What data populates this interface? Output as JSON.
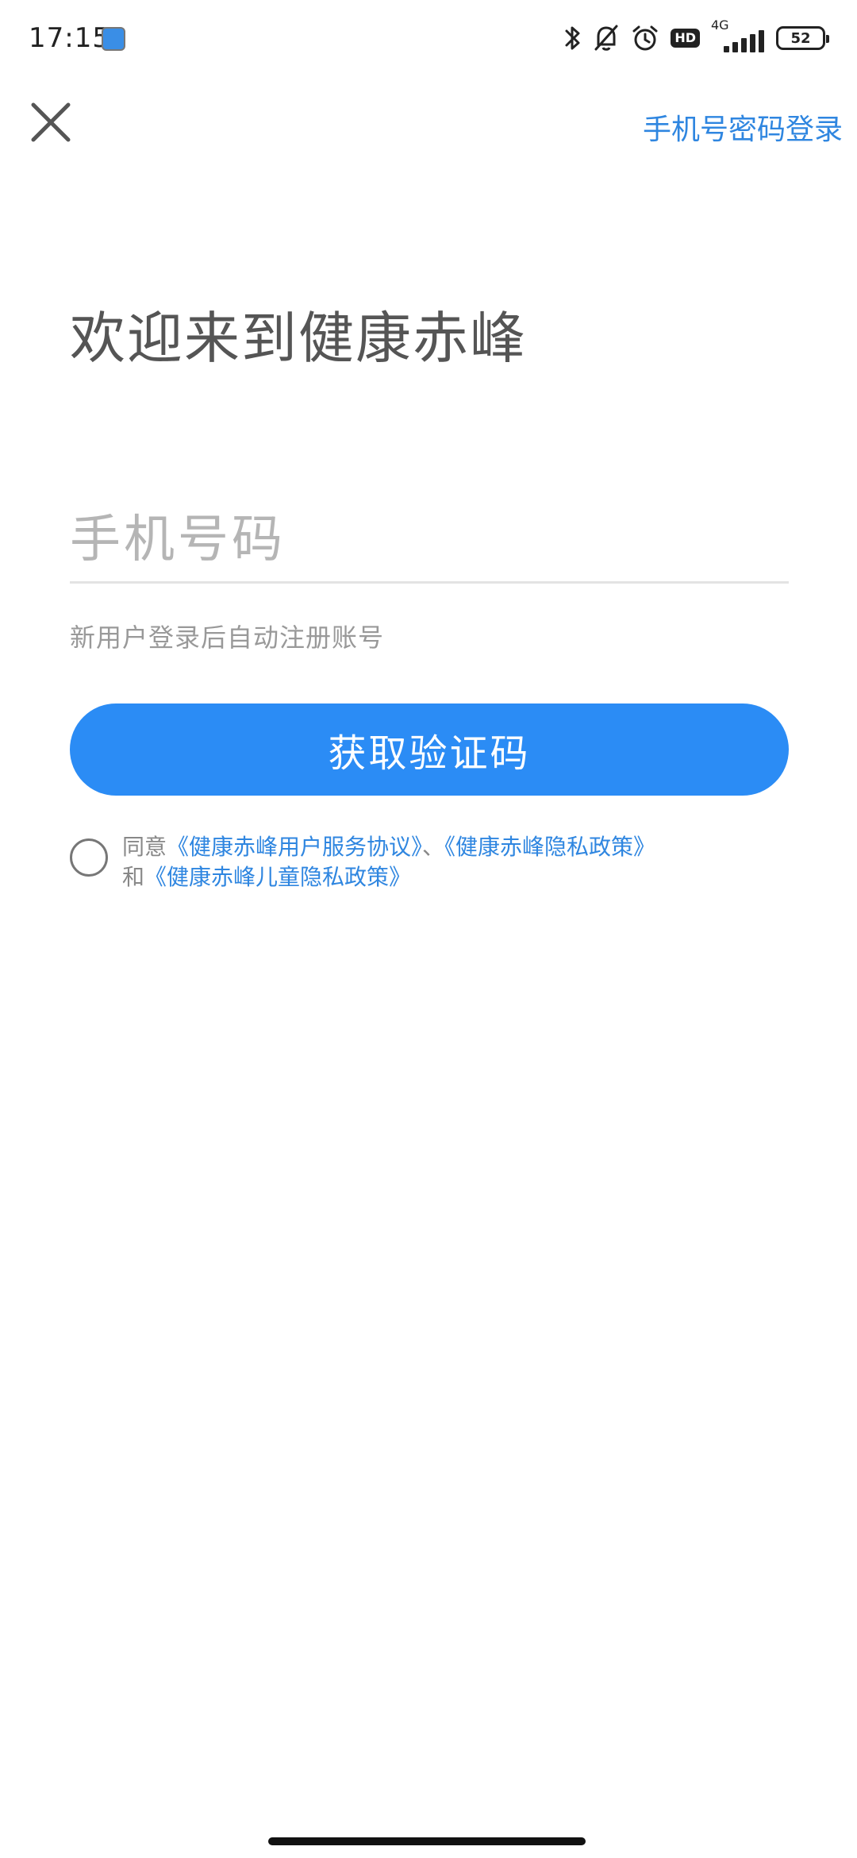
{
  "status_bar": {
    "time": "17:15",
    "network_type": "4G",
    "hd_label": "HD",
    "battery_level": "52",
    "icons": [
      "app-notification-icon",
      "bluetooth-icon",
      "bell-off-icon",
      "alarm-icon",
      "hd-icon",
      "signal-icon",
      "battery-icon"
    ]
  },
  "nav": {
    "close_icon": "close-icon",
    "password_login_label": "手机号密码登录"
  },
  "main": {
    "welcome_title": "欢迎来到健康赤峰",
    "phone_placeholder": "手机号码",
    "phone_value": "",
    "hint": "新用户登录后自动注册账号",
    "get_code_label": "获取验证码"
  },
  "agreement": {
    "checked": false,
    "prefix": "同意",
    "user_agreement": "《健康赤峰用户服务协议》",
    "separator": "、",
    "privacy_policy": "《健康赤峰隐私政策》",
    "and": "和",
    "child_privacy_policy": "《健康赤峰儿童隐私政策》"
  },
  "colors": {
    "accent": "#2b8cf5",
    "link": "#2f86e0",
    "title_text": "#555555",
    "hint_text": "#999999"
  }
}
